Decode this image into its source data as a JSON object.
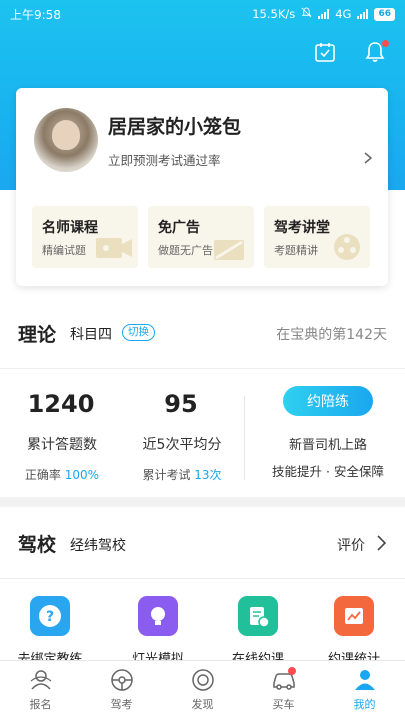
{
  "status_bar": {
    "time": "上午9:58",
    "network_speed": "15.5K/s",
    "network": "4G",
    "battery": "66"
  },
  "header": {
    "icons": [
      "calendar-check-icon",
      "bell-icon"
    ]
  },
  "profile": {
    "name": "居居家的小笼包",
    "subtitle": "立即预测考试通过率",
    "features": [
      {
        "title": "名师课程",
        "subtitle": "精编试题"
      },
      {
        "title": "免广告",
        "subtitle": "做题无广告"
      },
      {
        "title": "驾考讲堂",
        "subtitle": "考题精讲"
      }
    ]
  },
  "theory": {
    "title": "理论",
    "subject": "科目四",
    "switch_label": "切换",
    "day_text": "在宝典的第142天",
    "stats": {
      "answered_count": "1240",
      "answered_label": "累计答题数",
      "accuracy_prefix": "正确率",
      "accuracy_value": "100%",
      "avg_score": "95",
      "avg_label": "近5次平均分",
      "exam_prefix": "累计考试",
      "exam_value": "13次"
    },
    "accompany": {
      "button_label": "约陪练",
      "line1": "新晋司机上路",
      "line2": "技能提升 · 安全保障"
    }
  },
  "school": {
    "title": "驾校",
    "name": "经纬驾校",
    "rate_label": "评价"
  },
  "services": [
    {
      "label": "去绑定教练",
      "color": "#2aa5f0"
    },
    {
      "label": "灯光模拟",
      "color": "#8a5cf0"
    },
    {
      "label": "在线约课",
      "color": "#22c09a"
    },
    {
      "label": "约课统计",
      "color": "#f4683e"
    }
  ],
  "tabbar": {
    "tabs": [
      {
        "label": "报名"
      },
      {
        "label": "驾考"
      },
      {
        "label": "发现"
      },
      {
        "label": "买车"
      },
      {
        "label": "我的"
      }
    ],
    "active_index": 4
  },
  "colors": {
    "accent": "#1aa7ef",
    "badge_red": "#ff4d4f"
  }
}
